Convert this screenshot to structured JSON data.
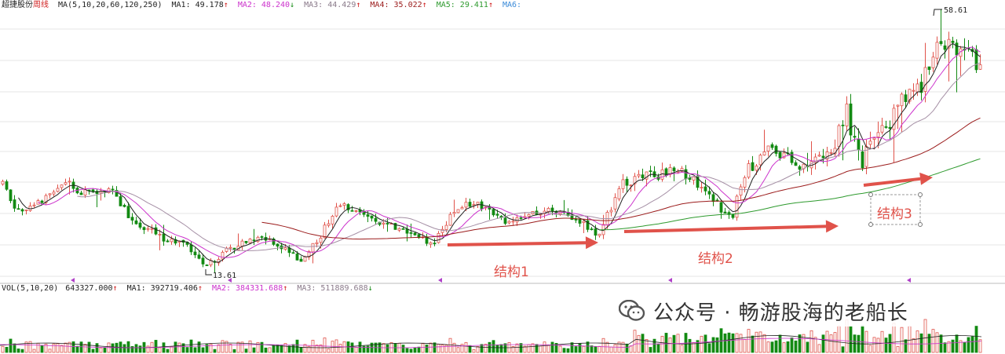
{
  "header": {
    "stock": "超捷股份",
    "period": "周线",
    "ma_label": "MA(5,10,20,60,120,250)",
    "ma1": "MA1: 49.178",
    "ma2": "MA2: 48.240",
    "ma3": "MA3: 44.429",
    "ma4": "MA4: 35.022",
    "ma5": "MA5: 29.411",
    "ma6": "MA6:",
    "arrow_up": "↑",
    "arrow_down": "↓"
  },
  "vol_header": {
    "label": "VOL(5,10,20)",
    "value": "643327.000",
    "ma1": "MA1: 392719.406",
    "ma2": "MA2: 384331.688",
    "ma3": "MA3: 511889.688"
  },
  "annotations": {
    "struct1": "结构1",
    "struct2": "结构2",
    "struct3": "结构3"
  },
  "watermark": {
    "text": "公众号 · 畅游股海的老船长",
    "icon": "wechat-icon"
  },
  "chart_data": {
    "type": "candlestick",
    "high_label": "58.61",
    "low_label": "13.61",
    "price_range": [
      12,
      62
    ],
    "colors": {
      "up": "#e0524a",
      "down": "#128a12",
      "ma1": "#222222",
      "ma2": "#cc33cc",
      "ma3": "#a58fa5",
      "ma4": "#9b1b1b",
      "ma5": "#2e9a2e",
      "arrow": "#e0524a"
    }
  }
}
